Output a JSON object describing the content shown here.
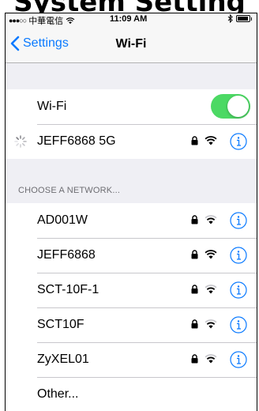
{
  "caption": "System Setting",
  "status_bar": {
    "carrier": "中華電信",
    "time": "11:09 AM"
  },
  "nav": {
    "back_label": "Settings",
    "title": "Wi-Fi"
  },
  "wifi_toggle": {
    "label": "Wi-Fi",
    "on": true
  },
  "connected": {
    "name": "JEFF6868 5G",
    "secured": true
  },
  "section_header": "CHOOSE A NETWORK...",
  "networks": [
    {
      "name": "AD001W",
      "secured": true,
      "signal": "medium"
    },
    {
      "name": "JEFF6868",
      "secured": true,
      "signal": "full"
    },
    {
      "name": "SCT-10F-1",
      "secured": true,
      "signal": "medium"
    },
    {
      "name": "SCT10F",
      "secured": true,
      "signal": "medium"
    },
    {
      "name": "ZyXEL01",
      "secured": true,
      "signal": "medium"
    },
    {
      "name": "Other...",
      "secured": false,
      "signal": "none"
    }
  ],
  "colors": {
    "accent": "#0a7aff",
    "toggle_on": "#4cd964",
    "background": "#efeff4"
  }
}
